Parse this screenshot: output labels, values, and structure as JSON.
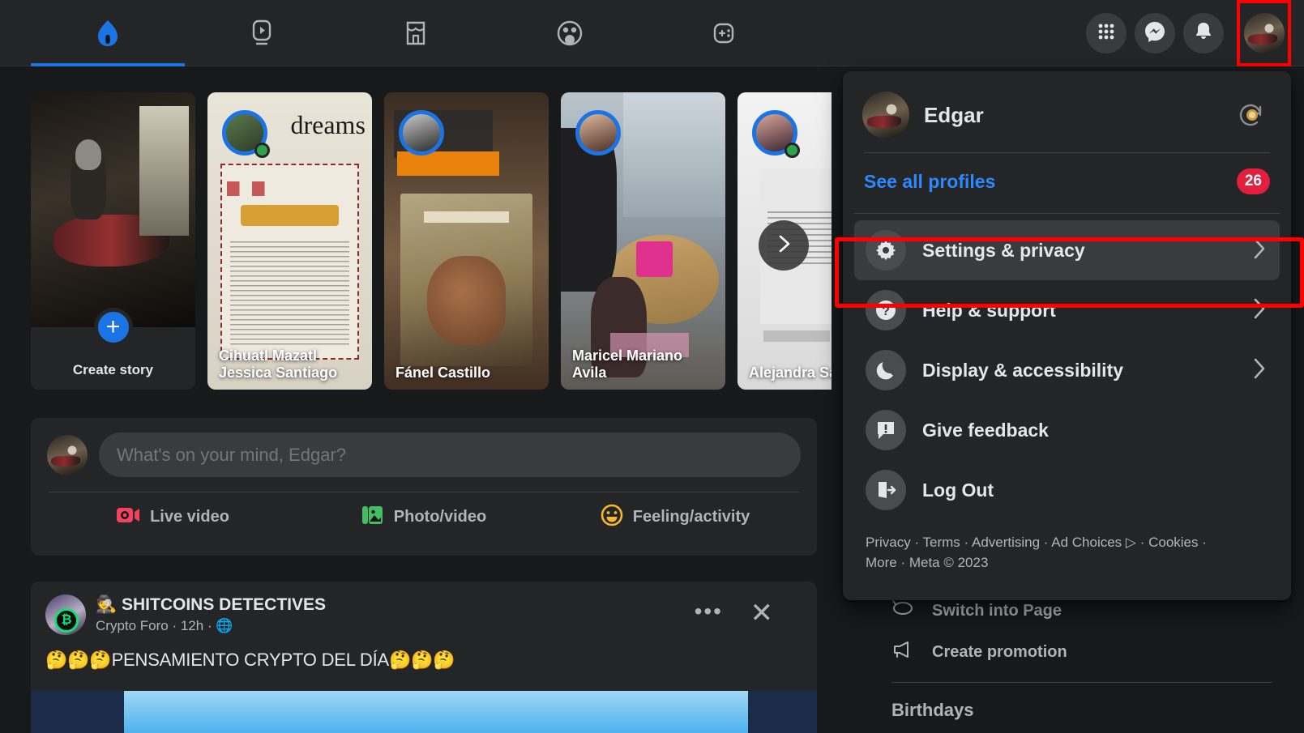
{
  "nav": {
    "tabs": [
      {
        "name": "home",
        "icon": "home-icon",
        "active": true
      },
      {
        "name": "video",
        "icon": "video-icon",
        "active": false
      },
      {
        "name": "marketplace",
        "icon": "marketplace-icon",
        "active": false
      },
      {
        "name": "groups",
        "icon": "groups-icon",
        "active": false
      },
      {
        "name": "gaming",
        "icon": "gaming-icon",
        "active": false
      }
    ],
    "right": [
      {
        "name": "menu-grid",
        "icon": "grid-icon"
      },
      {
        "name": "messenger",
        "icon": "messenger-icon"
      },
      {
        "name": "notifications",
        "icon": "bell-icon"
      },
      {
        "name": "account",
        "icon": "avatar"
      }
    ]
  },
  "stories": {
    "create": {
      "label": "Create story"
    },
    "items": [
      {
        "name": "Cihuatl Mazatl Jessica Santiago",
        "online": true
      },
      {
        "name": "Fánel Castillo",
        "online": false
      },
      {
        "name": "Maricel Mariano Avila",
        "online": false
      },
      {
        "name": "Alejandra Sanchez",
        "online": true
      }
    ],
    "next_label": "›"
  },
  "composer": {
    "placeholder": "What's on your mind, Edgar?",
    "actions": [
      {
        "label": "Live video",
        "color": "#F3425F",
        "icon": "live-video-icon"
      },
      {
        "label": "Photo/video",
        "color": "#45BD62",
        "icon": "photo-video-icon"
      },
      {
        "label": "Feeling/activity",
        "color": "#F7B928",
        "icon": "feeling-icon"
      }
    ]
  },
  "post": {
    "author": "🕵️ SHITCOINS DETECTIVES",
    "meta": "Crypto Foro · 12h · 🌐",
    "text": "🤔🤔🤔PENSAMIENTO CRYPTO DEL DÍA🤔🤔🤔",
    "menu_glyph": "•••",
    "close_glyph": "✕"
  },
  "rail": {
    "items": [
      {
        "label": "Switch into Page",
        "icon": "switch-page-icon"
      },
      {
        "label": "Create promotion",
        "icon": "megaphone-icon"
      }
    ],
    "heading": "Birthdays"
  },
  "menu": {
    "profile_name": "Edgar",
    "see_all_profiles": "See all profiles",
    "profile_badge": "26",
    "items": [
      {
        "label": "Settings & privacy",
        "icon": "gear-icon",
        "highlighted": true
      },
      {
        "label": "Help & support",
        "icon": "question-icon",
        "highlighted": false
      },
      {
        "label": "Display & accessibility",
        "icon": "moon-icon",
        "highlighted": false
      },
      {
        "label": "Give feedback",
        "icon": "feedback-icon",
        "highlighted": false
      },
      {
        "label": "Log Out",
        "icon": "logout-icon",
        "highlighted": false
      }
    ],
    "footer_line1": "Privacy · Terms · Advertising · Ad Choices ▷ · Cookies ·",
    "footer_line2": "More · Meta © 2023"
  },
  "colors": {
    "accent_blue": "#1B74E4",
    "link_blue": "#2D88FF",
    "badge_red": "#E41E3F",
    "highlight_red": "#FF0000",
    "panel": "#242526",
    "page": "#18191A"
  }
}
